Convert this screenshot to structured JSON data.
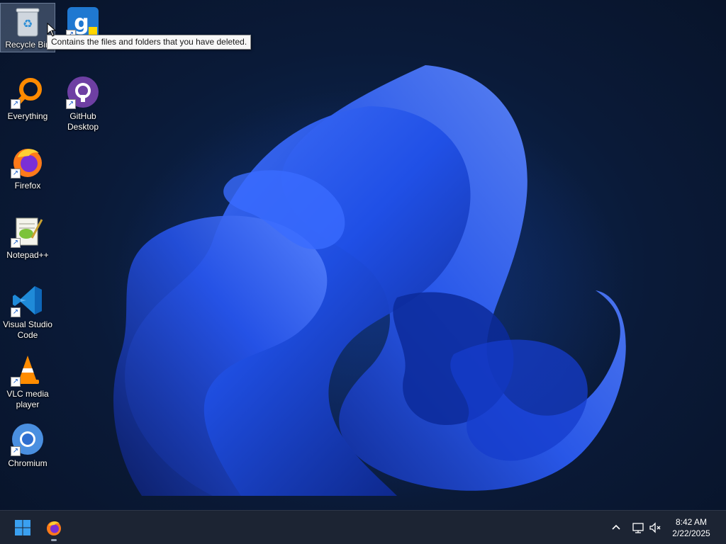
{
  "desktop": {
    "icons": [
      {
        "label": "Recycle Bin"
      },
      {
        "label": "Everything"
      },
      {
        "label": "GitHub\nDesktop"
      },
      {
        "label": "Firefox"
      },
      {
        "label": "Notepad++"
      },
      {
        "label": "Visual Studio\nCode"
      },
      {
        "label": "VLC media\nplayer"
      },
      {
        "label": "Chromium"
      }
    ],
    "tooltip": "Contains the files and folders that you have deleted."
  },
  "taskbar": {
    "clock": {
      "time": "8:42 AM",
      "date": "2/22/2025"
    }
  },
  "colors": {
    "taskbar_bg": "#1c2433",
    "accent": "#1f6fe0"
  }
}
